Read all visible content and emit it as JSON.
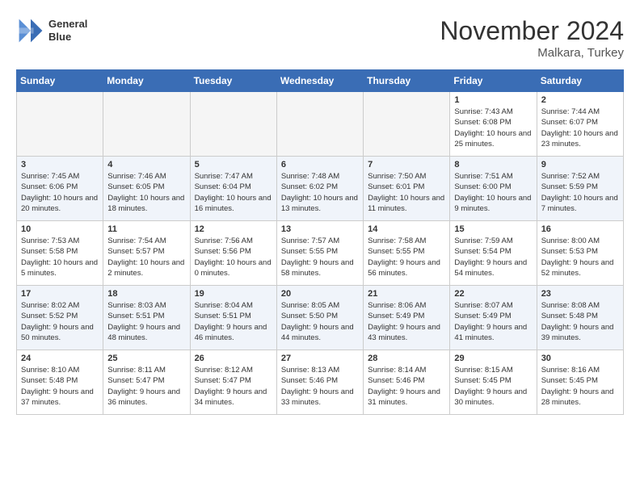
{
  "header": {
    "logo_line1": "General",
    "logo_line2": "Blue",
    "month": "November 2024",
    "location": "Malkara, Turkey"
  },
  "weekdays": [
    "Sunday",
    "Monday",
    "Tuesday",
    "Wednesday",
    "Thursday",
    "Friday",
    "Saturday"
  ],
  "weeks": [
    {
      "days": [
        {
          "num": "",
          "info": ""
        },
        {
          "num": "",
          "info": ""
        },
        {
          "num": "",
          "info": ""
        },
        {
          "num": "",
          "info": ""
        },
        {
          "num": "",
          "info": ""
        },
        {
          "num": "1",
          "info": "Sunrise: 7:43 AM\nSunset: 6:08 PM\nDaylight: 10 hours and 25 minutes."
        },
        {
          "num": "2",
          "info": "Sunrise: 7:44 AM\nSunset: 6:07 PM\nDaylight: 10 hours and 23 minutes."
        }
      ]
    },
    {
      "days": [
        {
          "num": "3",
          "info": "Sunrise: 7:45 AM\nSunset: 6:06 PM\nDaylight: 10 hours and 20 minutes."
        },
        {
          "num": "4",
          "info": "Sunrise: 7:46 AM\nSunset: 6:05 PM\nDaylight: 10 hours and 18 minutes."
        },
        {
          "num": "5",
          "info": "Sunrise: 7:47 AM\nSunset: 6:04 PM\nDaylight: 10 hours and 16 minutes."
        },
        {
          "num": "6",
          "info": "Sunrise: 7:48 AM\nSunset: 6:02 PM\nDaylight: 10 hours and 13 minutes."
        },
        {
          "num": "7",
          "info": "Sunrise: 7:50 AM\nSunset: 6:01 PM\nDaylight: 10 hours and 11 minutes."
        },
        {
          "num": "8",
          "info": "Sunrise: 7:51 AM\nSunset: 6:00 PM\nDaylight: 10 hours and 9 minutes."
        },
        {
          "num": "9",
          "info": "Sunrise: 7:52 AM\nSunset: 5:59 PM\nDaylight: 10 hours and 7 minutes."
        }
      ]
    },
    {
      "days": [
        {
          "num": "10",
          "info": "Sunrise: 7:53 AM\nSunset: 5:58 PM\nDaylight: 10 hours and 5 minutes."
        },
        {
          "num": "11",
          "info": "Sunrise: 7:54 AM\nSunset: 5:57 PM\nDaylight: 10 hours and 2 minutes."
        },
        {
          "num": "12",
          "info": "Sunrise: 7:56 AM\nSunset: 5:56 PM\nDaylight: 10 hours and 0 minutes."
        },
        {
          "num": "13",
          "info": "Sunrise: 7:57 AM\nSunset: 5:55 PM\nDaylight: 9 hours and 58 minutes."
        },
        {
          "num": "14",
          "info": "Sunrise: 7:58 AM\nSunset: 5:55 PM\nDaylight: 9 hours and 56 minutes."
        },
        {
          "num": "15",
          "info": "Sunrise: 7:59 AM\nSunset: 5:54 PM\nDaylight: 9 hours and 54 minutes."
        },
        {
          "num": "16",
          "info": "Sunrise: 8:00 AM\nSunset: 5:53 PM\nDaylight: 9 hours and 52 minutes."
        }
      ]
    },
    {
      "days": [
        {
          "num": "17",
          "info": "Sunrise: 8:02 AM\nSunset: 5:52 PM\nDaylight: 9 hours and 50 minutes."
        },
        {
          "num": "18",
          "info": "Sunrise: 8:03 AM\nSunset: 5:51 PM\nDaylight: 9 hours and 48 minutes."
        },
        {
          "num": "19",
          "info": "Sunrise: 8:04 AM\nSunset: 5:51 PM\nDaylight: 9 hours and 46 minutes."
        },
        {
          "num": "20",
          "info": "Sunrise: 8:05 AM\nSunset: 5:50 PM\nDaylight: 9 hours and 44 minutes."
        },
        {
          "num": "21",
          "info": "Sunrise: 8:06 AM\nSunset: 5:49 PM\nDaylight: 9 hours and 43 minutes."
        },
        {
          "num": "22",
          "info": "Sunrise: 8:07 AM\nSunset: 5:49 PM\nDaylight: 9 hours and 41 minutes."
        },
        {
          "num": "23",
          "info": "Sunrise: 8:08 AM\nSunset: 5:48 PM\nDaylight: 9 hours and 39 minutes."
        }
      ]
    },
    {
      "days": [
        {
          "num": "24",
          "info": "Sunrise: 8:10 AM\nSunset: 5:48 PM\nDaylight: 9 hours and 37 minutes."
        },
        {
          "num": "25",
          "info": "Sunrise: 8:11 AM\nSunset: 5:47 PM\nDaylight: 9 hours and 36 minutes."
        },
        {
          "num": "26",
          "info": "Sunrise: 8:12 AM\nSunset: 5:47 PM\nDaylight: 9 hours and 34 minutes."
        },
        {
          "num": "27",
          "info": "Sunrise: 8:13 AM\nSunset: 5:46 PM\nDaylight: 9 hours and 33 minutes."
        },
        {
          "num": "28",
          "info": "Sunrise: 8:14 AM\nSunset: 5:46 PM\nDaylight: 9 hours and 31 minutes."
        },
        {
          "num": "29",
          "info": "Sunrise: 8:15 AM\nSunset: 5:45 PM\nDaylight: 9 hours and 30 minutes."
        },
        {
          "num": "30",
          "info": "Sunrise: 8:16 AM\nSunset: 5:45 PM\nDaylight: 9 hours and 28 minutes."
        }
      ]
    }
  ]
}
